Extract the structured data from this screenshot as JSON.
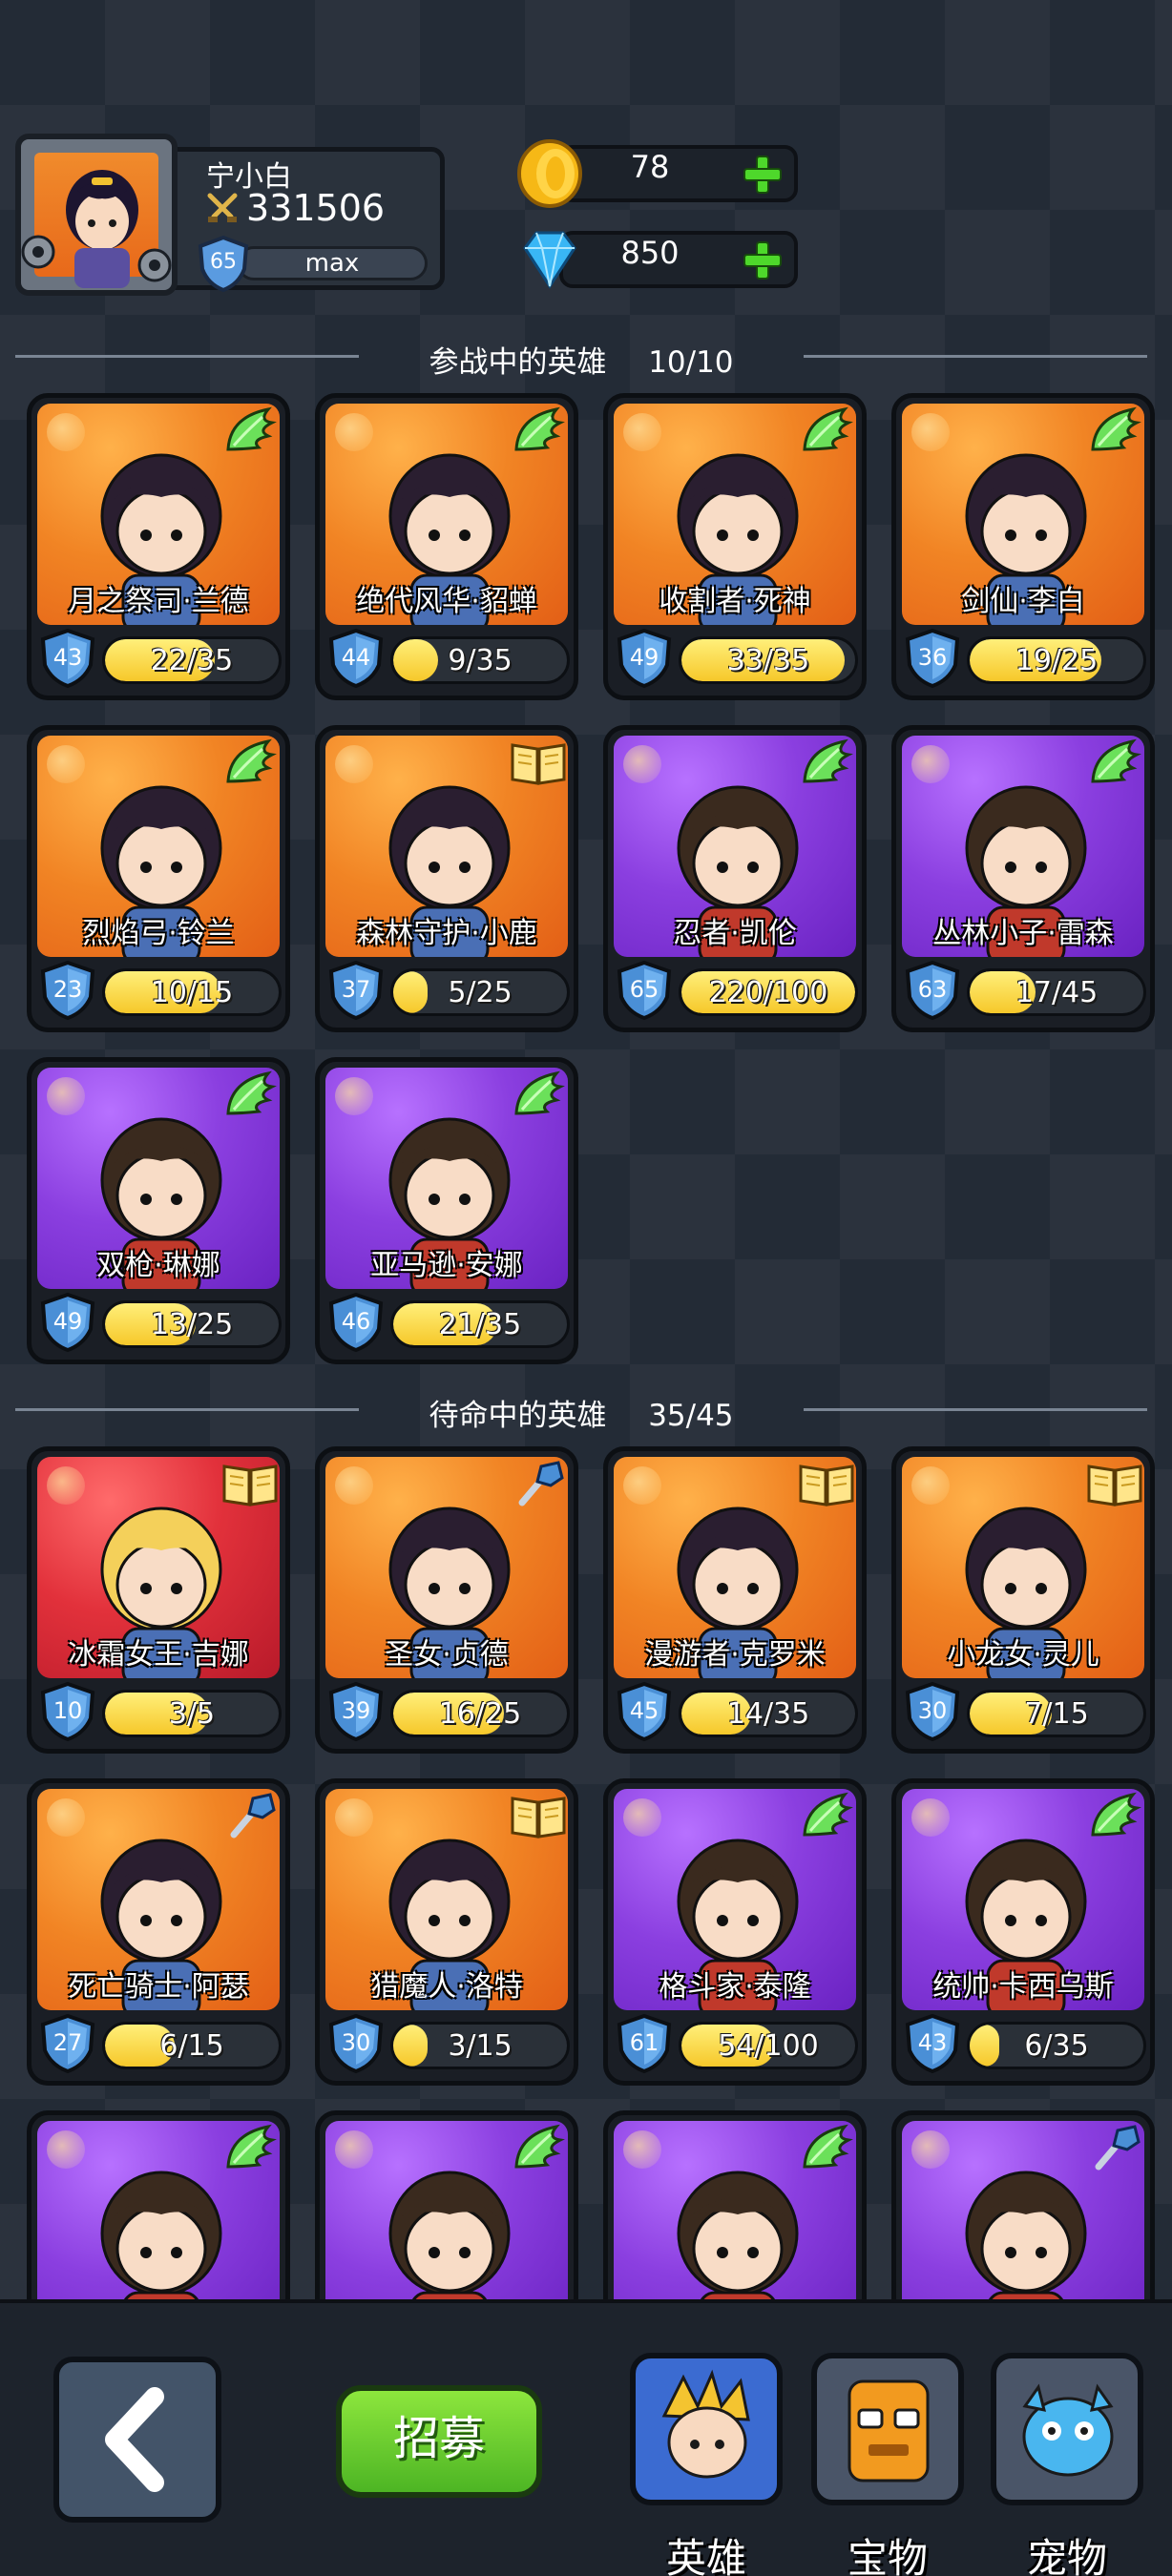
{
  "player": {
    "name": "宁小白",
    "power": "331506",
    "level": "65",
    "exp_label": "max"
  },
  "currencies": {
    "gold": "78",
    "diamond": "850"
  },
  "sections": {
    "deployed_title": "参战中的英雄",
    "deployed_count": "10/10",
    "standby_title": "待命中的英雄",
    "standby_count": "35/45"
  },
  "deployed_heroes": [
    {
      "name": "月之祭司·兰德",
      "level": "43",
      "progress": "22/35",
      "fill": 0.63,
      "bg": "orange",
      "type": "wing-icon"
    },
    {
      "name": "绝代风华·貂蝉",
      "level": "44",
      "progress": "9/35",
      "fill": 0.26,
      "bg": "orange",
      "type": "wing-icon"
    },
    {
      "name": "收割者·死神",
      "level": "49",
      "progress": "33/35",
      "fill": 0.94,
      "bg": "orange",
      "type": "wing-icon"
    },
    {
      "name": "剑仙·李白",
      "level": "36",
      "progress": "19/25",
      "fill": 0.76,
      "bg": "orange",
      "type": "wing-icon"
    },
    {
      "name": "烈焰弓·铃兰",
      "level": "23",
      "progress": "10/15",
      "fill": 0.67,
      "bg": "orange",
      "type": "wing-icon"
    },
    {
      "name": "森林守护·小鹿",
      "level": "37",
      "progress": "5/25",
      "fill": 0.2,
      "bg": "orange",
      "type": "book-icon"
    },
    {
      "name": "忍者·凯伦",
      "level": "65",
      "progress": "220/100",
      "fill": 1.0,
      "bg": "purple",
      "type": "wing-icon"
    },
    {
      "name": "丛林小子·雷森",
      "level": "63",
      "progress": "17/45",
      "fill": 0.38,
      "bg": "purple",
      "type": "wing-icon"
    },
    {
      "name": "双枪·琳娜",
      "level": "49",
      "progress": "13/25",
      "fill": 0.52,
      "bg": "purple",
      "type": "wing-icon"
    },
    {
      "name": "亚马逊·安娜",
      "level": "46",
      "progress": "21/35",
      "fill": 0.6,
      "bg": "purple",
      "type": "wing-icon"
    }
  ],
  "standby_heroes": [
    {
      "name": "冰霜女王·吉娜",
      "level": "10",
      "progress": "3/5",
      "fill": 0.6,
      "bg": "red",
      "type": "book-icon"
    },
    {
      "name": "圣女·贞德",
      "level": "39",
      "progress": "16/25",
      "fill": 0.64,
      "bg": "orange",
      "type": "shovel-icon"
    },
    {
      "name": "漫游者·克罗米",
      "level": "45",
      "progress": "14/35",
      "fill": 0.4,
      "bg": "orange",
      "type": "book-icon"
    },
    {
      "name": "小龙女·灵儿",
      "level": "30",
      "progress": "7/15",
      "fill": 0.47,
      "bg": "orange",
      "type": "book-icon"
    },
    {
      "name": "死亡骑士·阿瑟",
      "level": "27",
      "progress": "6/15",
      "fill": 0.4,
      "bg": "orange",
      "type": "shovel-icon"
    },
    {
      "name": "猎魔人·洛特",
      "level": "30",
      "progress": "3/15",
      "fill": 0.2,
      "bg": "orange",
      "type": "book-icon"
    },
    {
      "name": "格斗家·泰隆",
      "level": "61",
      "progress": "54/100",
      "fill": 0.54,
      "bg": "purple",
      "type": "wing-icon"
    },
    {
      "name": "统帅·卡西乌斯",
      "level": "43",
      "progress": "6/35",
      "fill": 0.17,
      "bg": "purple",
      "type": "wing-icon"
    },
    {
      "name": "",
      "level": "",
      "progress": "",
      "fill": 0,
      "bg": "purple",
      "type": "wing-icon"
    },
    {
      "name": "",
      "level": "",
      "progress": "",
      "fill": 0,
      "bg": "purple",
      "type": "wing-icon"
    },
    {
      "name": "",
      "level": "",
      "progress": "",
      "fill": 0,
      "bg": "purple",
      "type": "wing-icon"
    },
    {
      "name": "",
      "level": "",
      "progress": "",
      "fill": 0,
      "bg": "purple",
      "type": "shovel-icon"
    }
  ],
  "bottom_nav": {
    "recruit_label": "招募",
    "tabs": [
      {
        "label": "英雄",
        "icon": "hero-icon",
        "active": true
      },
      {
        "label": "宝物",
        "icon": "treasure-icon",
        "active": false
      },
      {
        "label": "宠物",
        "icon": "pet-icon",
        "active": false
      }
    ]
  },
  "colors": {
    "rarity_orange": "#f18424",
    "rarity_purple": "#8b3fe0",
    "rarity_red": "#e2313b",
    "progress_fill": "#f6c82a",
    "level_shield": "#4a8fd6",
    "recruit_green": "#4db524",
    "active_tab": "#3b6bd1"
  }
}
